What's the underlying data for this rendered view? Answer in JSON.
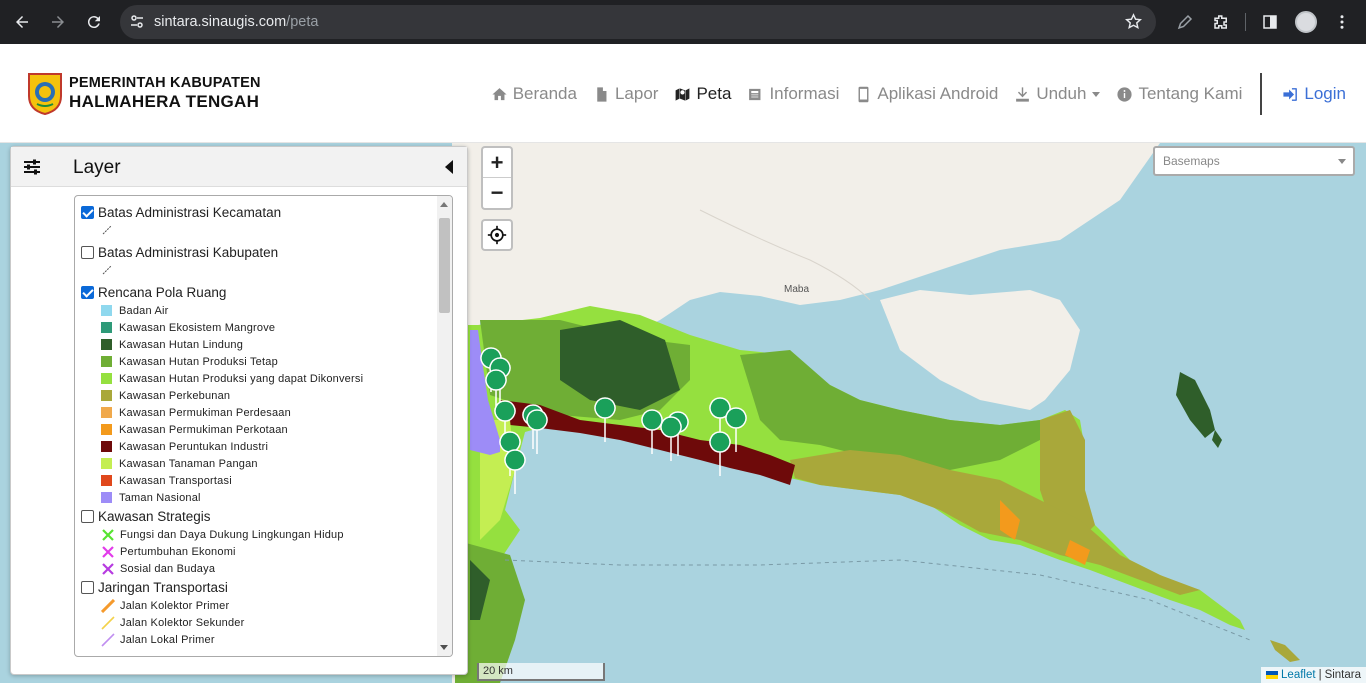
{
  "browser": {
    "url_host": "sintara.sinaugis.com",
    "url_path": "/peta"
  },
  "site": {
    "title_line1": "PEMERINTAH KABUPATEN",
    "title_line2": "HALMAHERA TENGAH"
  },
  "nav": {
    "items": [
      {
        "label": "Beranda",
        "icon": "home-icon"
      },
      {
        "label": "Lapor",
        "icon": "file-icon"
      },
      {
        "label": "Peta",
        "icon": "map-icon",
        "active": true
      },
      {
        "label": "Informasi",
        "icon": "newspaper-icon"
      },
      {
        "label": "Aplikasi Android",
        "icon": "mobile-icon"
      },
      {
        "label": "Unduh",
        "icon": "download-icon",
        "dropdown": true
      },
      {
        "label": "Tentang Kami",
        "icon": "info-icon"
      }
    ],
    "login": "Login"
  },
  "layer_panel": {
    "title": "Layer",
    "groups": [
      {
        "label": "Batas Administrasi Kecamatan",
        "checked": true
      },
      {
        "label": "Batas Administrasi Kabupaten",
        "checked": false
      },
      {
        "label": "Rencana Pola Ruang",
        "checked": true
      },
      {
        "label": "Kawasan Strategis",
        "checked": false
      },
      {
        "label": "Jaringan Transportasi",
        "checked": false
      }
    ],
    "pola_ruang_legend": [
      {
        "label": "Badan Air",
        "color": "#8fd8ee"
      },
      {
        "label": "Kawasan Ekosistem Mangrove",
        "color": "#2e9a78"
      },
      {
        "label": "Kawasan Hutan Lindung",
        "color": "#2f5e2a"
      },
      {
        "label": "Kawasan Hutan Produksi Tetap",
        "color": "#6fae35"
      },
      {
        "label": "Kawasan Hutan Produksi yang dapat Dikonversi",
        "color": "#95e03f"
      },
      {
        "label": "Kawasan Perkebunan",
        "color": "#a9a83a"
      },
      {
        "label": "Kawasan Permukiman Perdesaan",
        "color": "#f0a94c"
      },
      {
        "label": "Kawasan Permukiman Perkotaan",
        "color": "#f39a1c"
      },
      {
        "label": "Kawasan Peruntukan Industri",
        "color": "#6e0a0a"
      },
      {
        "label": "Kawasan Tanaman Pangan",
        "color": "#c4ee52"
      },
      {
        "label": "Kawasan Transportasi",
        "color": "#e0481c"
      },
      {
        "label": "Taman Nasional",
        "color": "#9d8cf7"
      }
    ],
    "strategis_legend": [
      {
        "label": "Fungsi dan Daya Dukung Lingkungan Hidup",
        "color": "#57e331"
      },
      {
        "label": "Pertumbuhan Ekonomi",
        "color": "#e23be9"
      },
      {
        "label": "Sosial dan Budaya",
        "color": "#b63be0"
      }
    ],
    "transport_legend": [
      {
        "label": "Jalan Kolektor Primer",
        "color": "#f59a2c"
      },
      {
        "label": "Jalan Kolektor Sekunder",
        "color": "#f3d24a"
      },
      {
        "label": "Jalan Lokal Primer",
        "color": "#c08ef0"
      }
    ]
  },
  "map": {
    "zoom_in": "+",
    "zoom_out": "−",
    "basemap_placeholder": "Basemaps",
    "place_label": "Maba",
    "scale": "20 km",
    "attribution_link": "Leaflet",
    "attribution_sep": "|",
    "attribution_owner": "Sintara"
  }
}
